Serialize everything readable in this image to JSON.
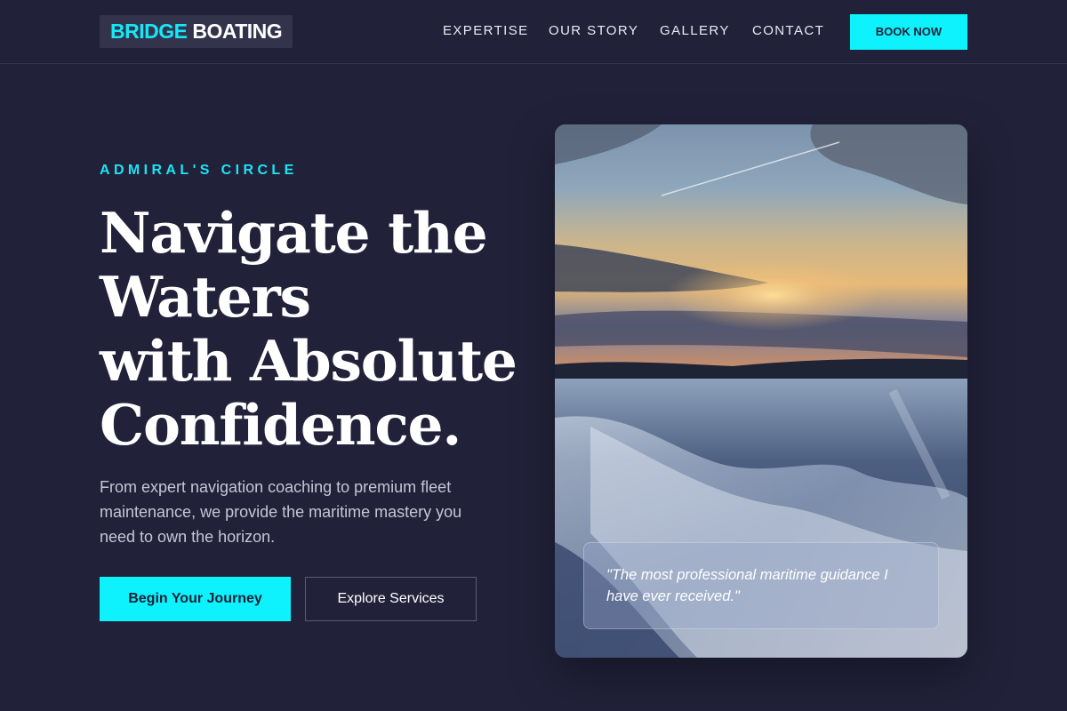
{
  "header": {
    "logo": {
      "accent": "BRIDGE",
      "rest": " BOATING"
    },
    "nav": [
      "EXPERTISE",
      "OUR STORY",
      "GALLERY",
      "CONTACT"
    ],
    "cta_label": "BOOK NOW"
  },
  "hero": {
    "eyebrow": "ADMIRAL'S CIRCLE",
    "headline": [
      "Navigate the",
      "Waters",
      "with Absolute",
      "Confidence."
    ],
    "subtext": "From expert navigation coaching to premium fleet maintenance, we provide the maritime mastery you need to own the horizon.",
    "primary_button": "Begin Your Journey",
    "secondary_button": "Explore Services"
  },
  "photo": {
    "subject": "sunset-boat-wake-photo",
    "quote": "\"The most professional maritime guidance I have ever received.\""
  },
  "colors": {
    "background": "#21223a",
    "accent": "#0df2fd",
    "text": "#ffffff",
    "muted_text": "#c4c6d6"
  }
}
